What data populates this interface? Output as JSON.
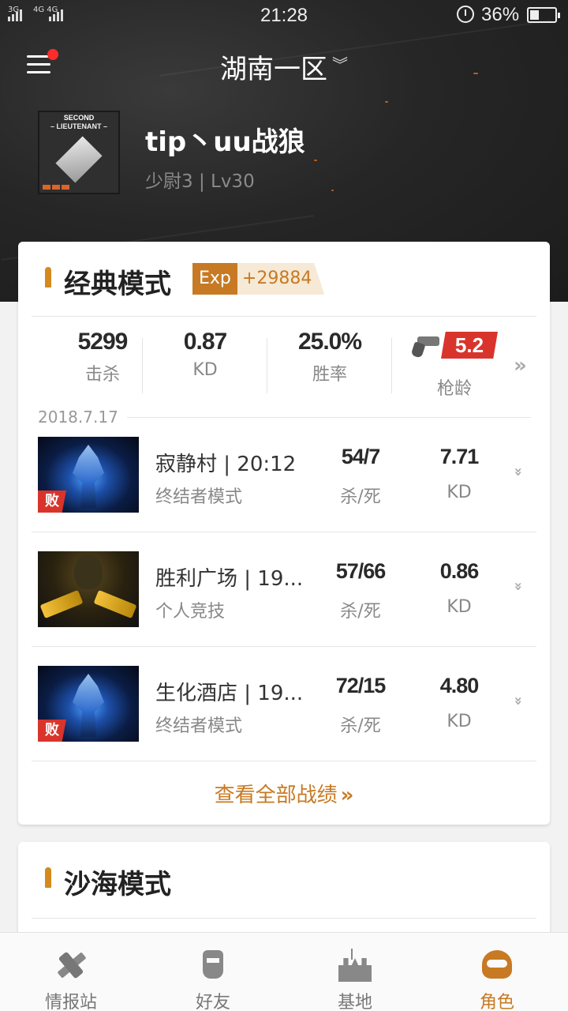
{
  "status_bar": {
    "signal_1": "3G",
    "signal_2": "4G 4G",
    "time": "21:28",
    "battery": "36%"
  },
  "header": {
    "server": "湖南一区",
    "rank_badge_line1": "SECOND",
    "rank_badge_line2": "– LIEUTENANT –",
    "nickname": "tip丶uu战狼",
    "rank_level": "少尉3 | Lv30"
  },
  "classic_mode": {
    "title": "经典模式",
    "exp_label": "Exp",
    "exp_value": "+29884",
    "stats": [
      {
        "value": "5299",
        "label": "击杀"
      },
      {
        "value": "0.87",
        "label": "KD"
      },
      {
        "value": "25.0%",
        "label": "胜率"
      }
    ],
    "gun_age": {
      "value": "5.2",
      "label": "枪龄"
    },
    "date": "2018.7.17",
    "matches": [
      {
        "title": "寂静村 | 20:12",
        "mode": "终结者模式",
        "kd_value": "54/7",
        "kd_label": "杀/死",
        "ratio_value": "7.71",
        "ratio_label": "KD",
        "result": "败"
      },
      {
        "title": "胜利广场 | 19...",
        "mode": "个人竞技",
        "kd_value": "57/66",
        "kd_label": "杀/死",
        "ratio_value": "0.86",
        "ratio_label": "KD",
        "result": ""
      },
      {
        "title": "生化酒店 | 19...",
        "mode": "终结者模式",
        "kd_value": "72/15",
        "kd_label": "杀/死",
        "ratio_value": "4.80",
        "ratio_label": "KD",
        "result": "败"
      }
    ],
    "view_all": "查看全部战绩"
  },
  "sand_mode": {
    "title": "沙海模式"
  },
  "tabs": [
    {
      "label": "情报站",
      "icon": "satellite-icon"
    },
    {
      "label": "好友",
      "icon": "soldier-icon"
    },
    {
      "label": "基地",
      "icon": "castle-icon"
    },
    {
      "label": "角色",
      "icon": "helmet-icon",
      "active": true
    }
  ],
  "colors": {
    "accent": "#c77a23",
    "loss": "#d9342b",
    "notification_dot": "#ff2a2a"
  }
}
